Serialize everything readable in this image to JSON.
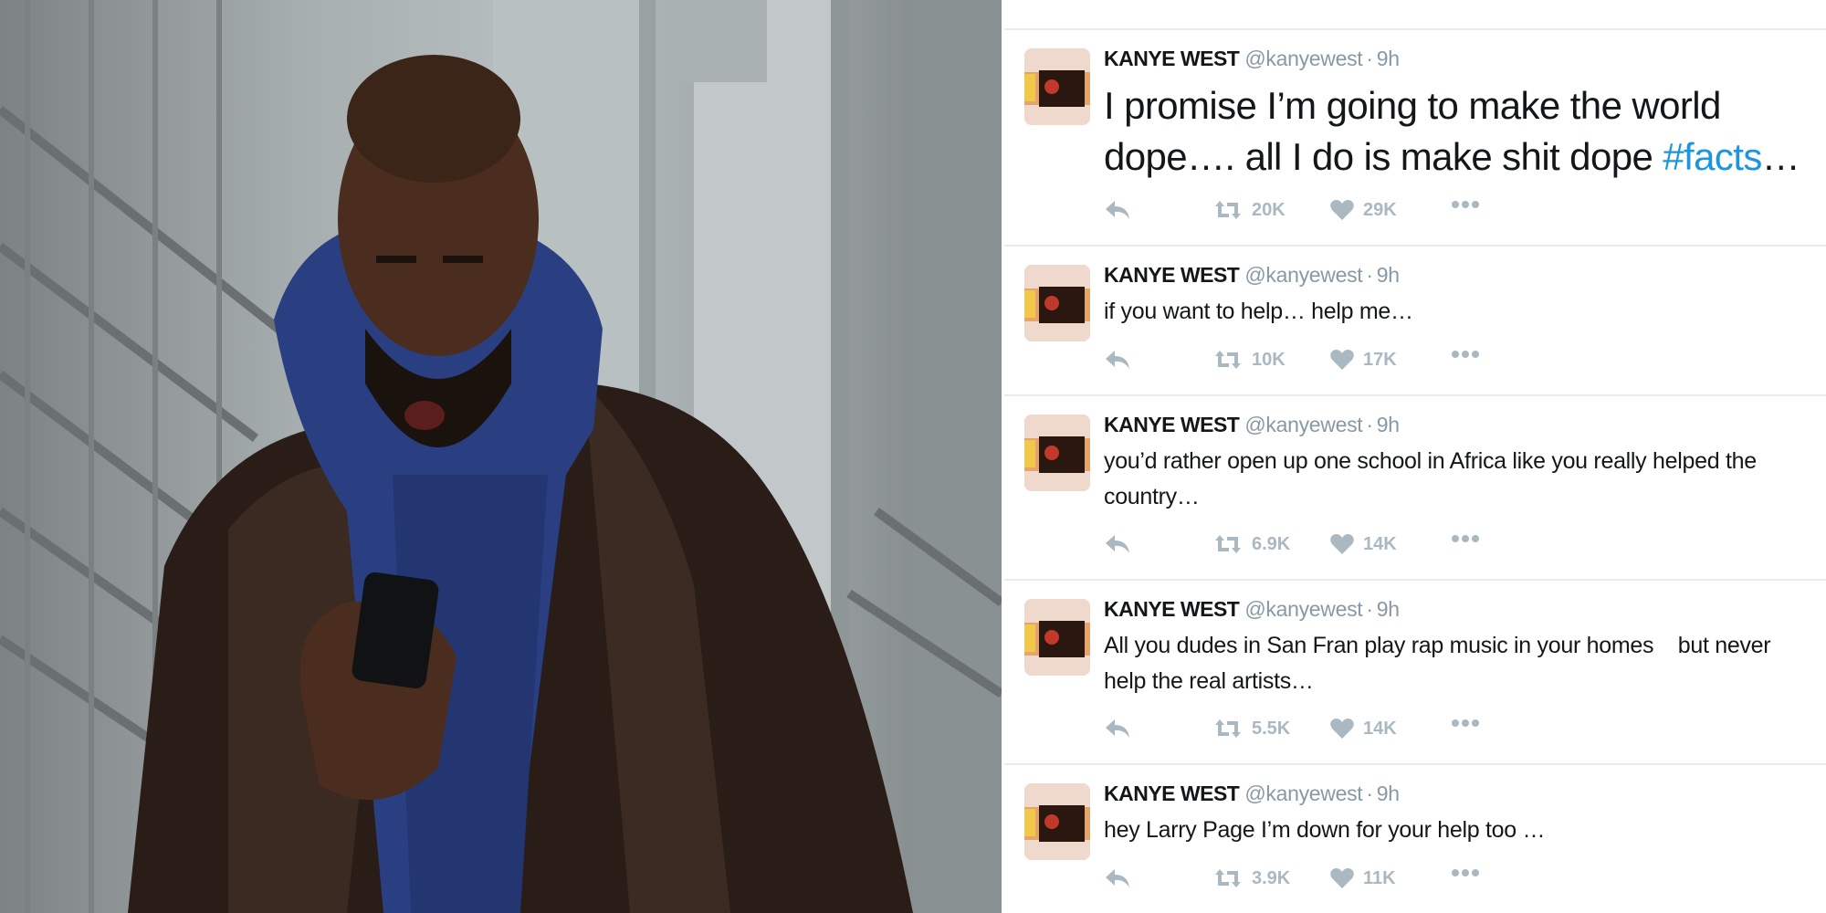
{
  "photo": {
    "description_icon": "person-photo",
    "colors": {
      "coat": "#2a1d17",
      "hoodie": "#2a3f82",
      "skin": "#4a2d1e",
      "phone": "#101214",
      "background": "#a7aeb0"
    }
  },
  "tweets": [
    {
      "name": "KANYE WEST",
      "handle": "@kanyewest",
      "separator": "·",
      "time": "9h",
      "text": "I promise I’m going to make the world dope…. all I do is make shit dope ",
      "hashtag": "#facts",
      "text_after": "…",
      "retweets": "20K",
      "likes": "29K"
    },
    {
      "name": "KANYE WEST",
      "handle": "@kanyewest",
      "separator": "·",
      "time": "9h",
      "text": "if you want to help… help me…",
      "retweets": "10K",
      "likes": "17K"
    },
    {
      "name": "KANYE WEST",
      "handle": "@kanyewest",
      "separator": "·",
      "time": "9h",
      "text": "you’d rather open up one school in Africa like you really helped the country…",
      "retweets": "6.9K",
      "likes": "14K"
    },
    {
      "name": "KANYE WEST",
      "handle": "@kanyewest",
      "separator": "·",
      "time": "9h",
      "text": "All you dudes in San Fran play rap music in your homes    but never help the real artists…",
      "retweets": "5.5K",
      "likes": "14K"
    },
    {
      "name": "KANYE WEST",
      "handle": "@kanyewest",
      "separator": "·",
      "time": "9h",
      "text": "hey Larry Page I’m down for your help too …",
      "retweets": "3.9K",
      "likes": "11K"
    }
  ],
  "icons": {
    "reply": "reply-icon",
    "retweet": "retweet-icon",
    "like": "heart-icon",
    "more": "more-dots-icon"
  },
  "colors": {
    "text": "#14171a",
    "muted": "#8899a6",
    "action": "#aab8c2",
    "link": "#1b95e0",
    "divider": "#e6ecf0"
  }
}
